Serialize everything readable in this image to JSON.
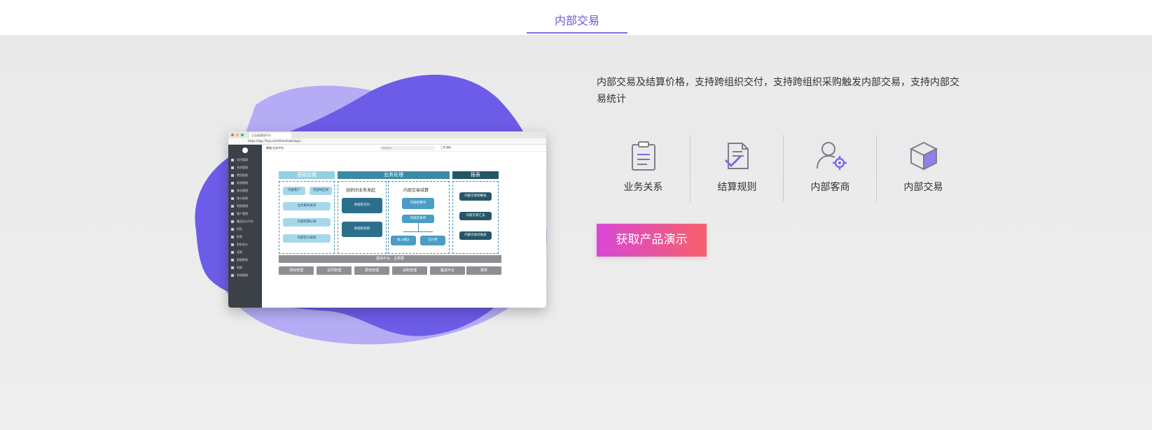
{
  "tabs": [
    {
      "label": "内部交易",
      "active": true
    }
  ],
  "description": "内部交易及结算价格，支持跨组织交付，支持跨组织采购触发内部交易，支持内部交易统计",
  "features": [
    {
      "label": "业务关系",
      "icon": "clipboard-icon"
    },
    {
      "label": "结算规则",
      "icon": "document-check-icon"
    },
    {
      "label": "内部客商",
      "icon": "user-gear-icon"
    },
    {
      "label": "内部交易",
      "icon": "cube-icon"
    }
  ],
  "cta_label": "获取产品演示",
  "colors": {
    "accent": "#6b5bd6",
    "blob_dark": "#6c5ce7",
    "blob_light": "#b5acf5",
    "cta_start": "#d847d6",
    "cta_end": "#f7606b"
  },
  "screenshot": {
    "browser_tab": "企业级管理平台",
    "url": "https://app.7hcp.com/#/ext/sale/app/...",
    "crumb": "数据·业务中台",
    "search_placeholder": "搜索菜单...",
    "tools": "工具   通知   ...",
    "sidebar_items": [
      "项目管理",
      "合同管理",
      "费用报表",
      "采购管理",
      "库存管理",
      "统计报表",
      "销售管理",
      "客户管理",
      "集团设计平台",
      "招标",
      "报表",
      "财务会计",
      "资源",
      "智能数据",
      "权限",
      "系统管理"
    ],
    "diagram": {
      "col1_head": "基础设置",
      "col2_head": "业务处理",
      "col3_head": "报表",
      "col1_items": [
        "内部客户",
        "内部供应商",
        "业务模式关系",
        "内部结算价格",
        "内部定价规则"
      ],
      "col2a_title": "组织间业务发起",
      "col2a_items": [
        "跨组织交付",
        "跨组织采购"
      ],
      "col2b_title": "内部交易结算",
      "col2b_items": [
        "内部结算单",
        "内部交易单",
        "收入确认",
        "应付单"
      ],
      "col3_items": [
        "内部交易明细表",
        "内部交易汇总",
        "内部交易对账表"
      ],
      "base_bar": "基础平台、主数据",
      "bottom_buttons": [
        "项目管理",
        "合同管理",
        "费用管理",
        "采购管理",
        "集成平台",
        "报表"
      ]
    }
  }
}
